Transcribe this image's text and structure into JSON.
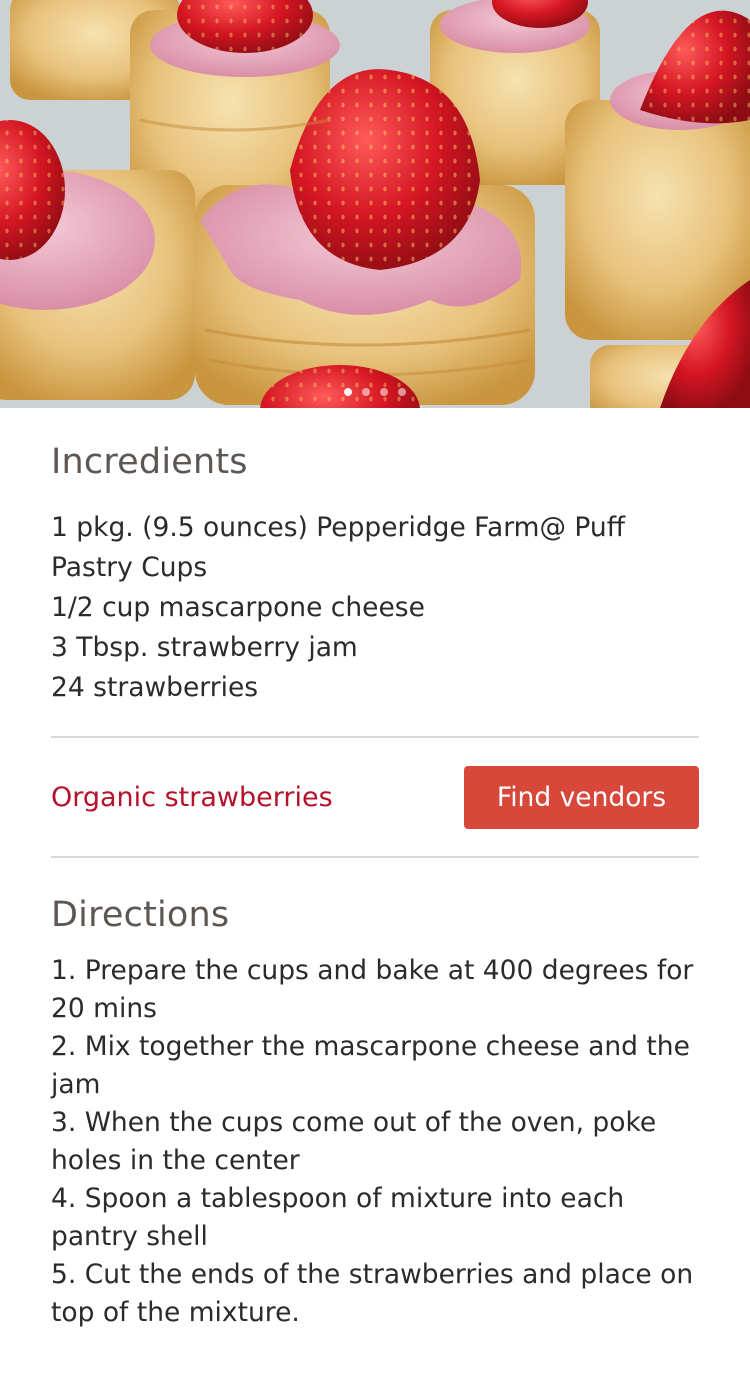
{
  "hero": {
    "image": "strawberry-puff-pastry-cups-photo",
    "carousel_dots": 4,
    "active_dot": 1
  },
  "ingredients": {
    "heading": "Incredients",
    "items": [
      "1 pkg. (9.5 ounces) Pepperidge Farm@ Puff Pastry Cups",
      "1/2 cup mascarpone cheese",
      "3 Tbsp. strawberry jam",
      "24 strawberries"
    ]
  },
  "vendor": {
    "link_label": "Organic strawberries",
    "button_label": "Find vendors",
    "link_color": "#b5122b",
    "button_color": "#d7473a"
  },
  "directions": {
    "heading": "Directions",
    "steps": [
      "1. Prepare the cups and bake at 400 degrees for 20 mins",
      "2. Mix together the mascarpone cheese and the jam",
      "3. When the cups come out of the oven, poke holes in the center",
      "4. Spoon a tablespoon of mixture into each pantry shell",
      "5. Cut the ends of the strawberries and place on top of the mixture."
    ]
  }
}
